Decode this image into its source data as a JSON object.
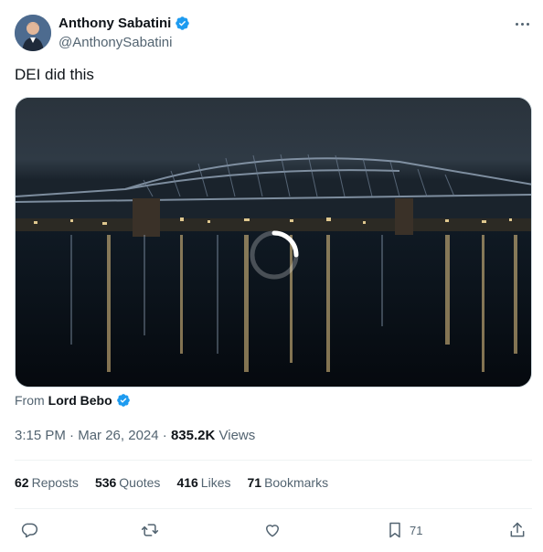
{
  "author": {
    "display_name": "Anthony Sabatini",
    "handle": "@AnthonySabatini",
    "avatar_icon": "person-avatar"
  },
  "tweet": {
    "text": "DEI did this",
    "media": {
      "description_icon": "video-loading-spinner-icon"
    },
    "from_label": "From",
    "from_name": "Lord Bebo",
    "time": "3:15 PM",
    "date": "Mar 26, 2024",
    "views_count": "835.2K",
    "views_label": "Views",
    "separator": "·"
  },
  "stats": {
    "reposts": {
      "count": "62",
      "label": "Reposts"
    },
    "quotes": {
      "count": "536",
      "label": "Quotes"
    },
    "likes": {
      "count": "416",
      "label": "Likes"
    },
    "bookmarks": {
      "count": "71",
      "label": "Bookmarks"
    }
  },
  "actions": {
    "bookmark_count": "71"
  },
  "colors": {
    "verified": "#1d9bf0",
    "secondary_text": "#536471",
    "primary_text": "#0f1419",
    "divider": "#eff3f4"
  }
}
